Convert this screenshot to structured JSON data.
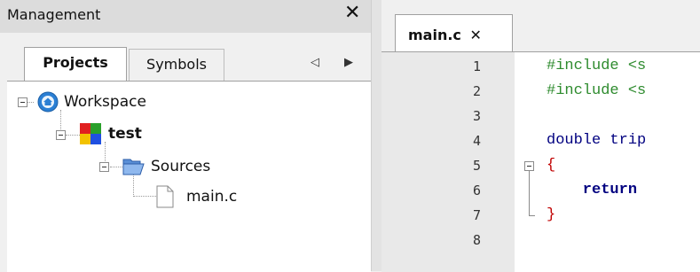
{
  "management": {
    "title": "Management",
    "close_glyph": "✕",
    "tabs": [
      {
        "label": "Projects",
        "active": true
      },
      {
        "label": "Symbols",
        "active": false
      }
    ],
    "tab_scroll_left": "◁",
    "tab_scroll_right": "▶",
    "tree": {
      "workspace": "Workspace",
      "project": "test",
      "folder": "Sources",
      "file": "main.c"
    },
    "icons": {
      "workspace": "workspace-globe-icon",
      "project": "project-blocks-icon",
      "folder": "folder-open-icon",
      "file": "file-icon"
    }
  },
  "editor": {
    "tab_label": "main.c",
    "tab_close": "✕",
    "lines": [
      {
        "num": "1",
        "text": "#include <s",
        "color": "#2e8b2e"
      },
      {
        "num": "2",
        "text": "#include <s",
        "color": "#2e8b2e"
      },
      {
        "num": "3",
        "text": "",
        "color": "#000000"
      },
      {
        "num": "4",
        "text": "double trip",
        "color": "#000080"
      },
      {
        "num": "5",
        "text": "{",
        "color": "#c00000"
      },
      {
        "num": "6",
        "text": "    return",
        "color": "#000080"
      },
      {
        "num": "7",
        "text": "}",
        "color": "#c00000"
      },
      {
        "num": "8",
        "text": "",
        "color": "#000000"
      }
    ]
  }
}
